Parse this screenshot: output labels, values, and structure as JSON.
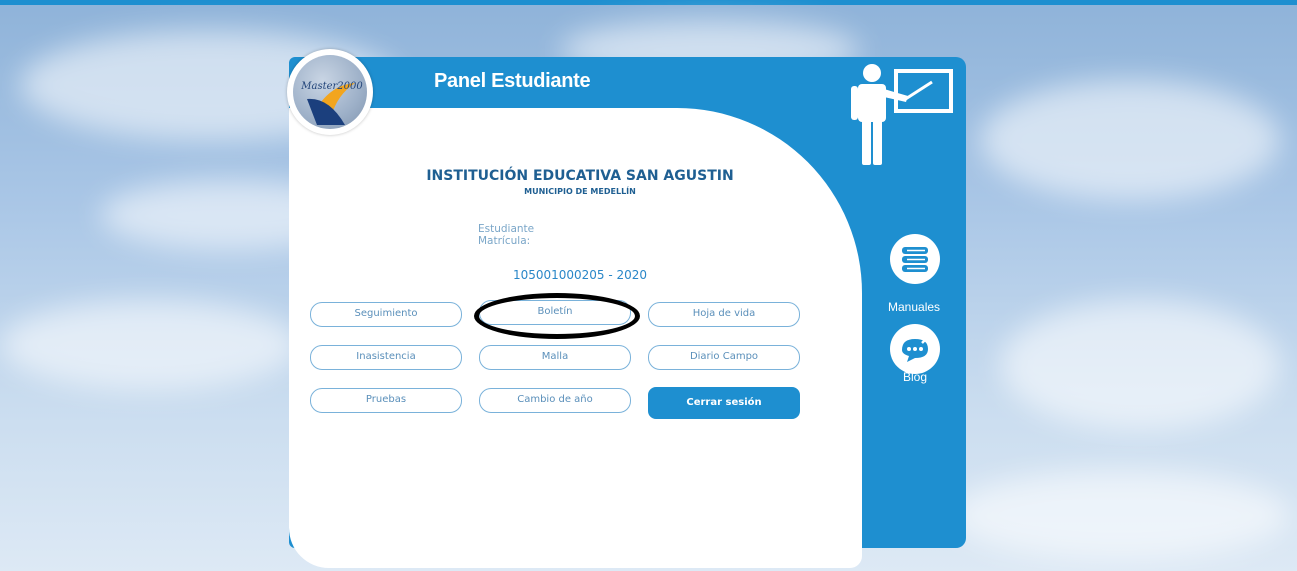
{
  "header": {
    "title": "Panel Estudiante",
    "logo_text": "Master2000"
  },
  "institution": {
    "name": "INSTITUCIÓN EDUCATIVA SAN AGUSTIN",
    "municipality": "MUNICIPIO DE MEDELLÍN"
  },
  "student": {
    "label_student": "Estudiante",
    "label_matricula": "Matrícula:",
    "matricula_value": "105001000205 - 2020"
  },
  "buttons": {
    "seguimiento": "Seguimiento",
    "boletin": "Boletín",
    "hoja_de_vida": "Hoja de vida",
    "inasistencia": "Inasistencia",
    "malla": "Malla",
    "diario_campo": "Diario Campo",
    "pruebas": "Pruebas",
    "cambio_de_anio": "Cambio de año",
    "cerrar_sesion": "Cerrar sesión"
  },
  "sidebar": {
    "manuales": "Manuales",
    "blog": "Blog"
  },
  "colors": {
    "brand_blue": "#1e8fd0",
    "button_border": "#7ab2da",
    "heading": "#1f5f92"
  },
  "icons": {
    "teacher": "teacher-board-icon",
    "manuales": "books-icon",
    "blog": "chat-bubble-icon"
  }
}
